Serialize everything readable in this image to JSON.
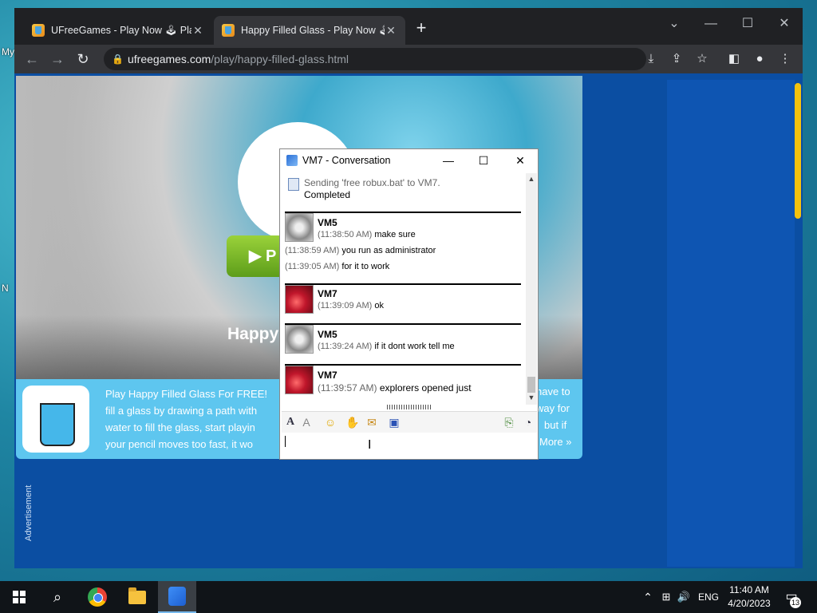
{
  "desktop": {
    "label_top": "My",
    "label_bottom": "N"
  },
  "browser": {
    "tabs": [
      {
        "title": "UFreeGames - Play Now 🕹 Play"
      },
      {
        "title": "Happy Filled Glass - Play Now 🕹"
      }
    ],
    "new_tab": "+",
    "url_host": "ufreegames.com",
    "url_path": "/play/happy-filled-glass.html"
  },
  "page": {
    "play_label": "▶ P",
    "game_title": "Happy",
    "description": "Play Happy Filled Glass For FREE! ... fill a glass by drawing a path with ... water to fill the glass, start playin ... your pencil moves too fast, it wo",
    "desc_lines": [
      "Play Happy Filled Glass For FREE!",
      "fill a glass by drawing a path with",
      "water to fill the glass, start playin",
      "your pencil moves too fast, it wo"
    ],
    "desc_right": [
      "have to",
      "way for",
      "but if",
      "More »"
    ],
    "advertisement": "Advertisement"
  },
  "conversation": {
    "title": "VM7 - Conversation",
    "file_transfer": "Sending 'free robux.bat' to VM7.",
    "file_status": "Completed",
    "messages": [
      {
        "sender": "VM5",
        "lines": [
          {
            "ts": "(11:38:50 AM)",
            "text": "make sure"
          },
          {
            "ts": "(11:38:59 AM)",
            "text": "you run as administrator"
          },
          {
            "ts": "(11:39:05 AM)",
            "text": "for it to work"
          }
        ]
      },
      {
        "sender": "VM7",
        "lines": [
          {
            "ts": "(11:39:09 AM)",
            "text": "ok"
          }
        ]
      },
      {
        "sender": "VM5",
        "lines": [
          {
            "ts": "(11:39:24 AM)",
            "text": "if it dont work tell me"
          }
        ]
      },
      {
        "sender": "VM7",
        "lines": [
          {
            "ts": "(11:39:57 AM)",
            "text": "explorers opened just"
          }
        ]
      }
    ]
  },
  "taskbar": {
    "language": "ENG",
    "time": "11:40 AM",
    "date": "4/20/2023",
    "notifications": "13"
  }
}
